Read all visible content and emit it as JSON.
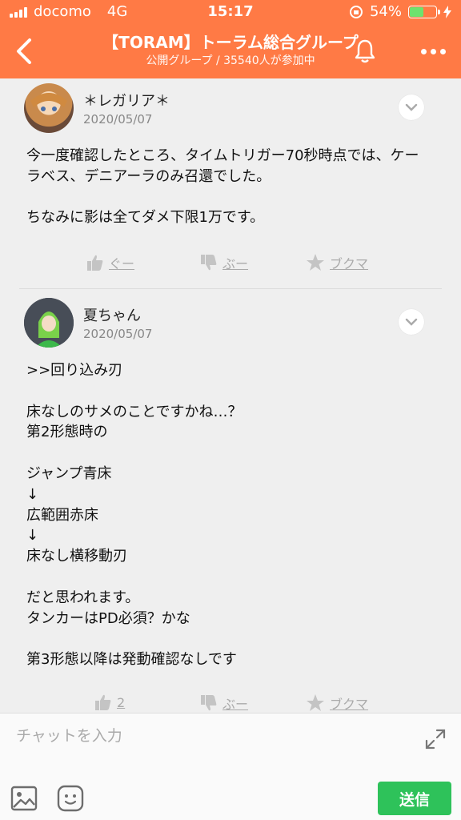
{
  "status_bar": {
    "carrier": "docomo",
    "network": "4G",
    "time": "15:17",
    "battery": "54%",
    "battery_level": 0.54
  },
  "header": {
    "title": "【TORAM】トーラム総合グループ",
    "subtitle": "公開グループ / 35540人が参加中",
    "accent": "#ff7a45"
  },
  "posts": [
    {
      "author": "＊レガリア＊",
      "date": "2020/05/07",
      "body": "今一度確認したところ、タイムトリガー70秒時点では、ケーラベス、デニアーラのみ召還でした。\n\nちなみに影は全てダメ下限1万です。",
      "like_label": "ぐー",
      "dislike_label": "ぶー",
      "bookmark_label": "ブクマ"
    },
    {
      "author": "夏ちゃん",
      "date": "2020/05/07",
      "body": ">>回り込み刃\n\n床なしのサメのことですかね…？\n第2形態時の\n\nジャンプ青床\n↓\n広範囲赤床\n↓\n床なし横移動刃\n\nだと思われます。\nタンカーはPD必須？かな\n\n第3形態以降は発動確認なしです",
      "like_label": "2",
      "dislike_label": "ぶー",
      "bookmark_label": "ブクマ"
    }
  ],
  "input": {
    "placeholder": "チャットを入力",
    "send_label": "送信",
    "send_color": "#2ec25a"
  }
}
